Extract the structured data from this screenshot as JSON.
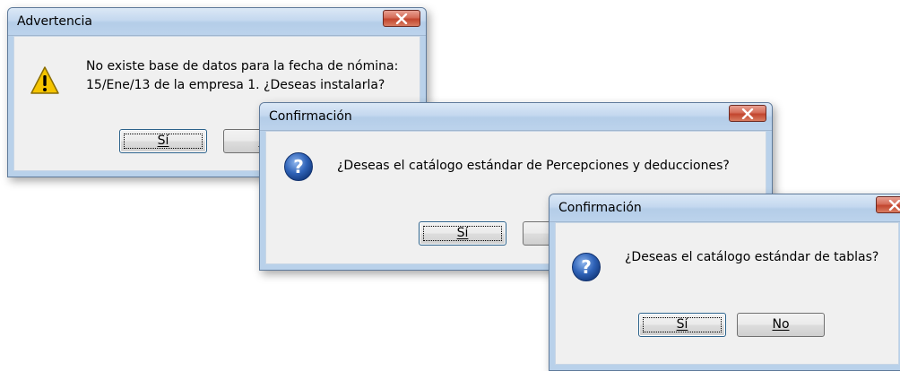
{
  "dialogs": [
    {
      "title": "Advertencia",
      "message_line1": "No existe base de datos para la fecha de nómina:",
      "message_line2": "15/Ene/13 de la empresa  1. ¿Deseas instalarla?",
      "icon": "warning-icon",
      "buttons": {
        "yes": "Sí",
        "no": "No"
      }
    },
    {
      "title": "Confirmación",
      "message": "¿Deseas el catálogo estándar de Percepciones y deducciones?",
      "icon": "question-icon",
      "buttons": {
        "yes": "Sí",
        "no": "No"
      }
    },
    {
      "title": "Confirmación",
      "message": "¿Deseas el catálogo estándar de tablas?",
      "icon": "question-icon",
      "buttons": {
        "yes": "Sí",
        "no": "No"
      }
    }
  ],
  "colors": {
    "title_bar": "#c4d8ef",
    "close_button": "#c2452e",
    "client_area": "#f0f0f0",
    "question_icon": "#2f63b8",
    "warning_icon": "#f5c400"
  }
}
